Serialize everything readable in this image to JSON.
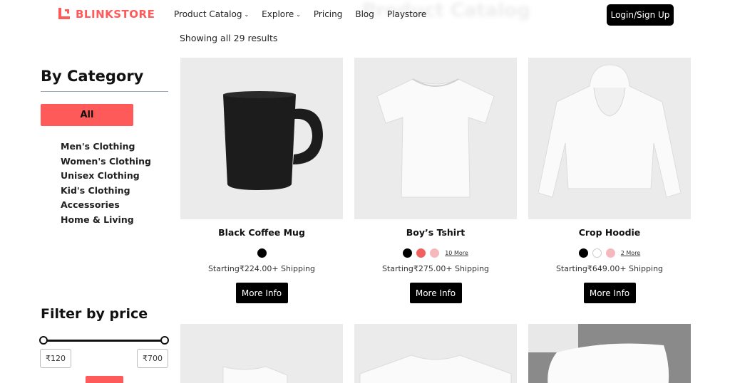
{
  "header": {
    "logo_text": "BLINKSTORE",
    "brand_color": "#ff5a5a",
    "nav": [
      {
        "label": "Product Catalog",
        "has_dropdown": true
      },
      {
        "label": "Explore",
        "has_dropdown": true
      },
      {
        "label": "Pricing",
        "has_dropdown": false
      },
      {
        "label": "Blog",
        "has_dropdown": false
      },
      {
        "label": "Playstore",
        "has_dropdown": false
      }
    ],
    "ghost_title": "Product Catalog",
    "login_label": "Login/Sign Up"
  },
  "results_text": "Showing all 29 results",
  "sidebar": {
    "category_title": "By Category",
    "all_label": "All",
    "categories": [
      "Men's Clothing",
      "Women's Clothing",
      "Unisex Clothing",
      "Kid's Clothing",
      "Accessories",
      "Home & Living"
    ],
    "price_title": "Filter by price",
    "min_price": "₹120",
    "max_price": "₹700"
  },
  "products": [
    {
      "name": "Black Coffee Mug",
      "swatches": [
        "#000000"
      ],
      "more": "",
      "price": "Starting₹224.00+ Shipping",
      "button": "More Info",
      "image_icon": "mug-icon"
    },
    {
      "name": "Boy’s Tshirt",
      "swatches": [
        "#000000",
        "#f06060",
        "#f5b8bc"
      ],
      "more": "10 More",
      "price": "Starting₹275.00+ Shipping",
      "button": "More Info",
      "image_icon": "tshirt-icon"
    },
    {
      "name": "Crop Hoodie",
      "swatches": [
        "#000000",
        "#ffffff",
        "#f5b8bc"
      ],
      "more": "2 More",
      "price": "Starting₹649.00+ Shipping",
      "button": "More Info",
      "image_icon": "hoodie-icon"
    }
  ]
}
